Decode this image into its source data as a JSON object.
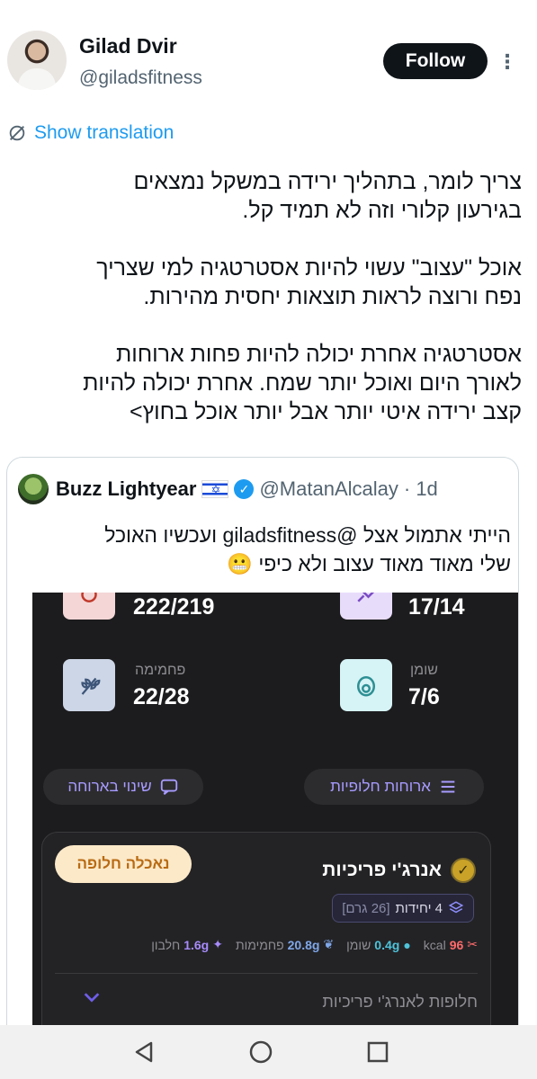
{
  "author": {
    "name": "Gilad Dvir",
    "handle": "@giladsfitness",
    "follow_label": "Follow",
    "more_label": "⋮"
  },
  "translate_label": "Show translation",
  "tweet_text": "צריך לומר, בתהליך ירידה במשקל נמצאים\nבגירעון קלורי וזה לא תמיד קל.\n\nאוכל \"עצוב\" עשוי להיות אסטרטגיה למי שצריך\nנפח ורוצה לראות תוצאות יחסית מהירות.\n\nאסטרטגיה אחרת יכולה להיות פחות ארוחות\nלאורך היום ואוכל יותר שמח. אחרת יכולה להיות\nקצב ירידה איטי יותר אבל יותר אוכל בחוץ>",
  "quote": {
    "name": "Buzz Lightyear",
    "handle": "@MatanAlcalay",
    "time": "· 1d",
    "text": "הייתי אתמול אצל @giladsfitness ועכשיו האוכל\nשלי מאוד מאוד עצוב ולא כיפי 😬"
  },
  "app": {
    "stats": {
      "calories_value": "222/219",
      "protein_value": "17/14",
      "carbs_label": "פחמימה",
      "carbs_value": "22/28",
      "fat_label": "שומן",
      "fat_value": "7/6"
    },
    "swap_meal_label": "שינוי בארוחה",
    "alt_meals_label": "ארוחות חלופיות",
    "meal": {
      "title": "אנרג'י פריכיות",
      "swap_badge": "נאכלה חלופה",
      "units_count": "4 יחידות",
      "units_grams": "[26 גרם]",
      "kcal_value": "96",
      "kcal_label": "kcal",
      "fat_value": "0.4g",
      "fat_label": "שומן",
      "carbs_value": "20.8g",
      "carbs_label": "פחמימות",
      "protein_value": "1.6g",
      "protein_label": "חלבון",
      "alts_label": "חלופות לאנרג'י פריכיות"
    },
    "colors": {
      "accent": "#a79bff",
      "background": "#1c1c1e",
      "badge_bg": "#fce9c8",
      "badge_text": "#b96a12"
    }
  },
  "icons": [
    "translate-icon",
    "flag-israel-icon",
    "verified-icon",
    "flame-icon",
    "drumstick-icon",
    "wheat-icon",
    "avocado-icon",
    "chat-icon",
    "list-icon",
    "check-icon",
    "layers-icon",
    "chevron-down-icon",
    "back-icon",
    "home-icon",
    "recents-icon"
  ]
}
